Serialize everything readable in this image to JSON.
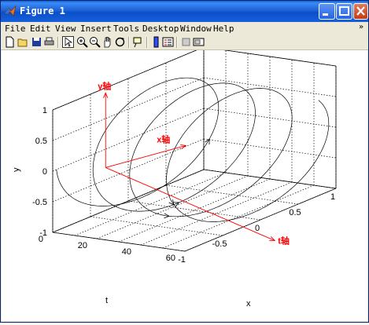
{
  "window": {
    "title": "Figure 1"
  },
  "menu": {
    "items": [
      "File",
      "Edit",
      "View",
      "Insert",
      "Tools",
      "Desktop",
      "Window",
      "Help"
    ],
    "underlined": [
      "F",
      "E",
      "V",
      "I",
      "T",
      "D",
      "W",
      "H"
    ],
    "overflow_icon": "double-chevron-icon"
  },
  "toolbar": {
    "buttons": [
      "new-figure-icon",
      "open-file-icon",
      "save-icon",
      "print-icon",
      "pointer-icon",
      "zoom-in-icon",
      "zoom-out-icon",
      "pan-hand-icon",
      "rotate-3d-icon",
      "data-cursor-icon",
      "colorbar-icon",
      "legend-icon",
      "hide-plot-tools-icon",
      "show-plot-tools-icon"
    ]
  },
  "chart_data": {
    "type": "line3d",
    "description_of_plot": null,
    "series": [
      {
        "name": "",
        "t": [
          0,
          60
        ],
        "x": "cos",
        "y": "sin"
      }
    ],
    "axes": {
      "xlabel": "x",
      "ylabel": "y",
      "zlabel": "t",
      "xlim": [
        -1,
        1
      ],
      "ylim": [
        -1,
        1
      ],
      "tlim": [
        0,
        60
      ],
      "xticks": [
        "-1",
        "-0.5",
        "0",
        "0.5",
        "1"
      ],
      "yticks": [
        "-1",
        "-0.5",
        "0",
        "0.5",
        "1"
      ],
      "tticks": [
        "0",
        "20",
        "40",
        "60"
      ],
      "grid": true
    },
    "annotations": {
      "y_axis_label": "y轴",
      "x_axis_label": "x轴",
      "t_axis_label": "t轴"
    },
    "colors": {
      "curve": "#000000",
      "annotation": "#ff0000",
      "grid": "#000000"
    }
  }
}
